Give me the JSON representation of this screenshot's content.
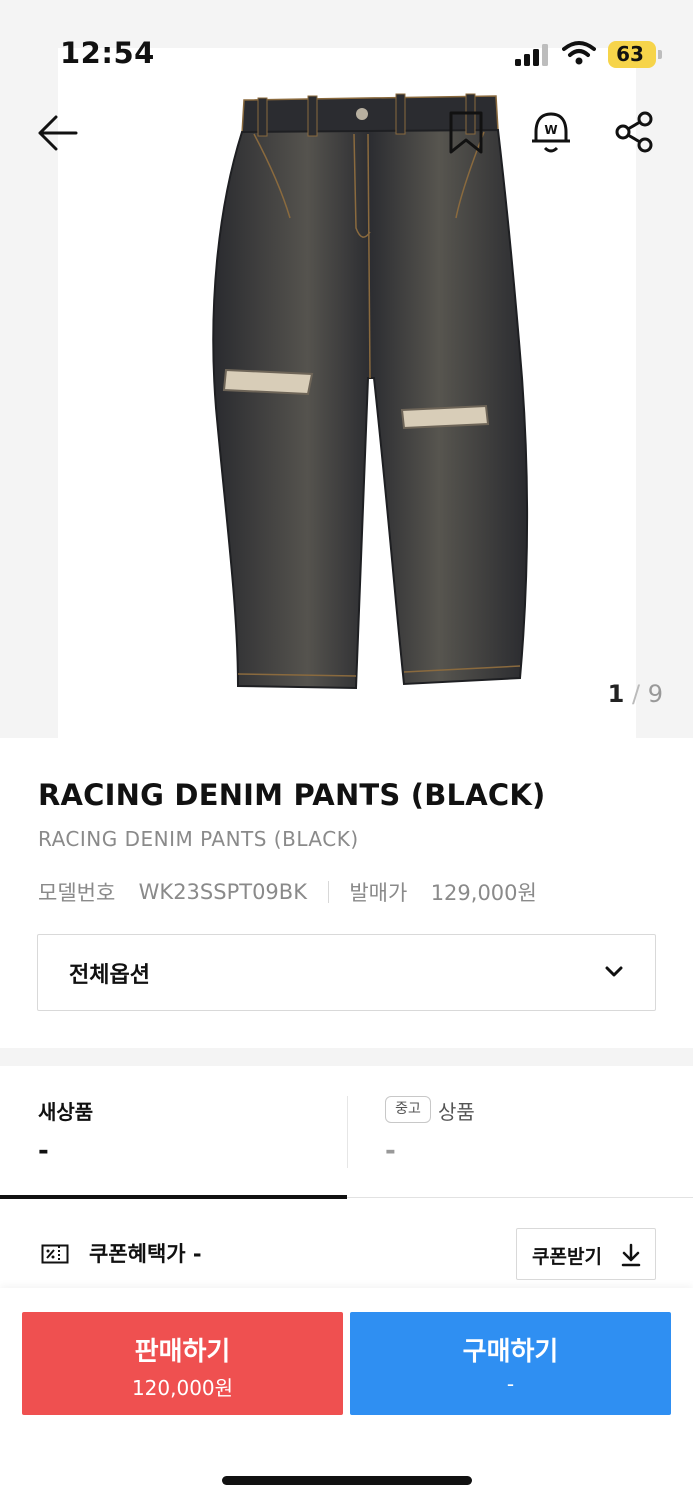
{
  "status_bar": {
    "time": "12:54",
    "battery": "63"
  },
  "gallery": {
    "current": "1",
    "separator": "/",
    "total": "9"
  },
  "product": {
    "name": "RACING DENIM PANTS (BLACK)",
    "subname": "RACING DENIM PANTS (BLACK)",
    "model_label": "모델번호",
    "model_number": "WK23SSPT09BK",
    "release_label": "발매가",
    "release_price": "129,000원"
  },
  "option_select": {
    "label": "전체옵션"
  },
  "tabs": [
    {
      "label": "새상품",
      "value": "-"
    },
    {
      "badge": "중고",
      "label": "상품",
      "value": "-"
    }
  ],
  "coupon": {
    "text": "쿠폰혜택가 -",
    "button_label": "쿠폰받기"
  },
  "actions": {
    "sell": {
      "label": "판매하기",
      "price": "120,000원"
    },
    "buy": {
      "label": "구매하기",
      "price": "-"
    }
  },
  "colors": {
    "sell": "#ef5050",
    "buy": "#2f8ff2",
    "battery": "#f6d44a"
  },
  "icons": [
    "back-arrow-icon",
    "bookmark-icon",
    "price-alert-bell-icon",
    "share-icon",
    "chevron-down-icon",
    "coupon-icon",
    "download-icon"
  ]
}
